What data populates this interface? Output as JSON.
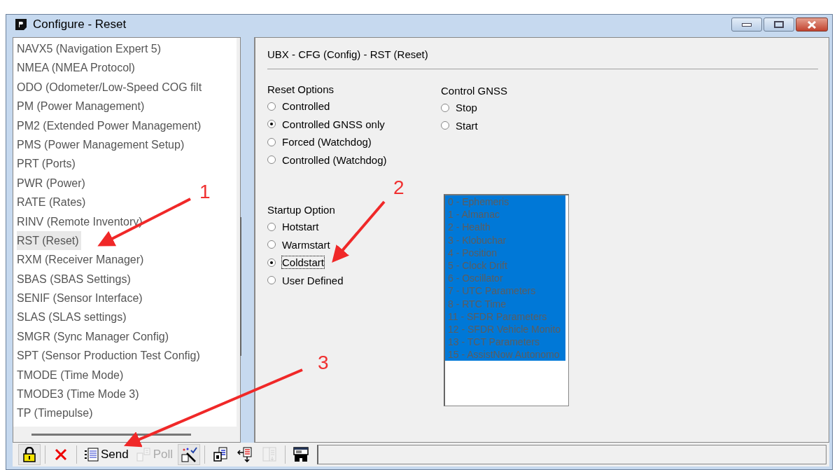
{
  "window": {
    "title": "Configure - Reset"
  },
  "sidebar": {
    "items": [
      {
        "label": "NAVX5 (Navigation Expert 5)",
        "selected": false
      },
      {
        "label": "NMEA (NMEA Protocol)",
        "selected": false
      },
      {
        "label": "ODO (Odometer/Low-Speed COG filt",
        "selected": false
      },
      {
        "label": "PM (Power Management)",
        "selected": false
      },
      {
        "label": "PM2 (Extended Power Management)",
        "selected": false
      },
      {
        "label": "PMS (Power Management Setup)",
        "selected": false
      },
      {
        "label": "PRT (Ports)",
        "selected": false
      },
      {
        "label": "PWR (Power)",
        "selected": false
      },
      {
        "label": "RATE (Rates)",
        "selected": false
      },
      {
        "label": "RINV (Remote Inventory)",
        "selected": false
      },
      {
        "label": "RST (Reset)",
        "selected": true
      },
      {
        "label": "RXM (Receiver Manager)",
        "selected": false
      },
      {
        "label": "SBAS (SBAS Settings)",
        "selected": false
      },
      {
        "label": "SENIF (Sensor Interface)",
        "selected": false
      },
      {
        "label": "SLAS (SLAS settings)",
        "selected": false
      },
      {
        "label": "SMGR (Sync Manager Config)",
        "selected": false
      },
      {
        "label": "SPT (Sensor Production Test Config)",
        "selected": false
      },
      {
        "label": "TMODE (Time Mode)",
        "selected": false
      },
      {
        "label": "TMODE3 (Time Mode 3)",
        "selected": false
      },
      {
        "label": "TP (Timepulse)",
        "selected": false
      }
    ]
  },
  "panel": {
    "heading": "UBX - CFG (Config) - RST (Reset)",
    "reset_options": {
      "label": "Reset Options",
      "options": [
        {
          "label": "Controlled",
          "selected": false
        },
        {
          "label": "Controlled GNSS only",
          "selected": true
        },
        {
          "label": "Forced (Watchdog)",
          "selected": false
        },
        {
          "label": "Controlled (Watchdog)",
          "selected": false
        }
      ]
    },
    "control_gnss": {
      "label": "Control GNSS",
      "options": [
        {
          "label": "Stop",
          "selected": false
        },
        {
          "label": "Start",
          "selected": false
        }
      ]
    },
    "startup_option": {
      "label": "Startup Option",
      "options": [
        {
          "label": "Hotstart",
          "selected": false,
          "focused": false
        },
        {
          "label": "Warmstart",
          "selected": false,
          "focused": false
        },
        {
          "label": "Coldstart",
          "selected": true,
          "focused": true
        },
        {
          "label": "User Defined",
          "selected": false,
          "focused": false
        }
      ]
    },
    "clear_list": {
      "disabled": true,
      "items": [
        {
          "label": "0 - Ephemeris",
          "selected": true
        },
        {
          "label": "1 - Almanac",
          "selected": true
        },
        {
          "label": "2 - Health",
          "selected": true
        },
        {
          "label": "3 - Klobuchar",
          "selected": true
        },
        {
          "label": "4 - Position",
          "selected": true
        },
        {
          "label": "5 - Clock Drift",
          "selected": true
        },
        {
          "label": "6 - Oscillator",
          "selected": true
        },
        {
          "label": "7 - UTC Parameters",
          "selected": true
        },
        {
          "label": "8 - RTC Time",
          "selected": true
        },
        {
          "label": "11 - SFDR Parameters",
          "selected": true
        },
        {
          "label": "12 - SFDR Vehicle Monito",
          "selected": true
        },
        {
          "label": "13 - TCT Parameters",
          "selected": true
        },
        {
          "label": "15 - AssistNow Autonomo",
          "selected": true
        }
      ]
    }
  },
  "toolbar": [
    {
      "kind": "lock",
      "pressed": true,
      "disabled": false
    },
    {
      "kind": "separator"
    },
    {
      "kind": "delete",
      "pressed": false,
      "disabled": false
    },
    {
      "kind": "separator"
    },
    {
      "kind": "send",
      "label": "Send",
      "pressed": false,
      "disabled": false
    },
    {
      "kind": "poll",
      "label": "Poll",
      "pressed": false,
      "disabled": true
    },
    {
      "kind": "wand",
      "pressed": true,
      "disabled": false
    },
    {
      "kind": "separator"
    },
    {
      "kind": "document",
      "pressed": false,
      "disabled": false
    },
    {
      "kind": "import",
      "pressed": false,
      "disabled": false
    },
    {
      "kind": "export",
      "pressed": false,
      "disabled": true
    },
    {
      "kind": "separator"
    },
    {
      "kind": "binoculars",
      "pressed": false,
      "disabled": false
    }
  ],
  "annotations": [
    {
      "label": "1"
    },
    {
      "label": "2"
    },
    {
      "label": "3"
    }
  ]
}
